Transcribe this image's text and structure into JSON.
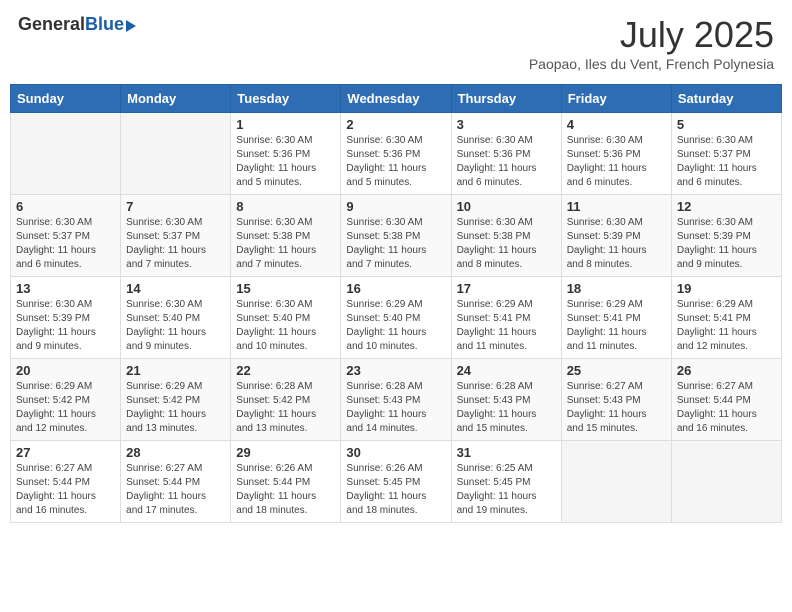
{
  "header": {
    "logo_general": "General",
    "logo_blue": "Blue",
    "month_title": "July 2025",
    "location": "Paopao, Iles du Vent, French Polynesia"
  },
  "weekdays": [
    "Sunday",
    "Monday",
    "Tuesday",
    "Wednesday",
    "Thursday",
    "Friday",
    "Saturday"
  ],
  "weeks": [
    [
      {
        "day": "",
        "info": ""
      },
      {
        "day": "",
        "info": ""
      },
      {
        "day": "1",
        "info": "Sunrise: 6:30 AM\nSunset: 5:36 PM\nDaylight: 11 hours and 5 minutes."
      },
      {
        "day": "2",
        "info": "Sunrise: 6:30 AM\nSunset: 5:36 PM\nDaylight: 11 hours and 5 minutes."
      },
      {
        "day": "3",
        "info": "Sunrise: 6:30 AM\nSunset: 5:36 PM\nDaylight: 11 hours and 6 minutes."
      },
      {
        "day": "4",
        "info": "Sunrise: 6:30 AM\nSunset: 5:36 PM\nDaylight: 11 hours and 6 minutes."
      },
      {
        "day": "5",
        "info": "Sunrise: 6:30 AM\nSunset: 5:37 PM\nDaylight: 11 hours and 6 minutes."
      }
    ],
    [
      {
        "day": "6",
        "info": "Sunrise: 6:30 AM\nSunset: 5:37 PM\nDaylight: 11 hours and 6 minutes."
      },
      {
        "day": "7",
        "info": "Sunrise: 6:30 AM\nSunset: 5:37 PM\nDaylight: 11 hours and 7 minutes."
      },
      {
        "day": "8",
        "info": "Sunrise: 6:30 AM\nSunset: 5:38 PM\nDaylight: 11 hours and 7 minutes."
      },
      {
        "day": "9",
        "info": "Sunrise: 6:30 AM\nSunset: 5:38 PM\nDaylight: 11 hours and 7 minutes."
      },
      {
        "day": "10",
        "info": "Sunrise: 6:30 AM\nSunset: 5:38 PM\nDaylight: 11 hours and 8 minutes."
      },
      {
        "day": "11",
        "info": "Sunrise: 6:30 AM\nSunset: 5:39 PM\nDaylight: 11 hours and 8 minutes."
      },
      {
        "day": "12",
        "info": "Sunrise: 6:30 AM\nSunset: 5:39 PM\nDaylight: 11 hours and 9 minutes."
      }
    ],
    [
      {
        "day": "13",
        "info": "Sunrise: 6:30 AM\nSunset: 5:39 PM\nDaylight: 11 hours and 9 minutes."
      },
      {
        "day": "14",
        "info": "Sunrise: 6:30 AM\nSunset: 5:40 PM\nDaylight: 11 hours and 9 minutes."
      },
      {
        "day": "15",
        "info": "Sunrise: 6:30 AM\nSunset: 5:40 PM\nDaylight: 11 hours and 10 minutes."
      },
      {
        "day": "16",
        "info": "Sunrise: 6:29 AM\nSunset: 5:40 PM\nDaylight: 11 hours and 10 minutes."
      },
      {
        "day": "17",
        "info": "Sunrise: 6:29 AM\nSunset: 5:41 PM\nDaylight: 11 hours and 11 minutes."
      },
      {
        "day": "18",
        "info": "Sunrise: 6:29 AM\nSunset: 5:41 PM\nDaylight: 11 hours and 11 minutes."
      },
      {
        "day": "19",
        "info": "Sunrise: 6:29 AM\nSunset: 5:41 PM\nDaylight: 11 hours and 12 minutes."
      }
    ],
    [
      {
        "day": "20",
        "info": "Sunrise: 6:29 AM\nSunset: 5:42 PM\nDaylight: 11 hours and 12 minutes."
      },
      {
        "day": "21",
        "info": "Sunrise: 6:29 AM\nSunset: 5:42 PM\nDaylight: 11 hours and 13 minutes."
      },
      {
        "day": "22",
        "info": "Sunrise: 6:28 AM\nSunset: 5:42 PM\nDaylight: 11 hours and 13 minutes."
      },
      {
        "day": "23",
        "info": "Sunrise: 6:28 AM\nSunset: 5:43 PM\nDaylight: 11 hours and 14 minutes."
      },
      {
        "day": "24",
        "info": "Sunrise: 6:28 AM\nSunset: 5:43 PM\nDaylight: 11 hours and 15 minutes."
      },
      {
        "day": "25",
        "info": "Sunrise: 6:27 AM\nSunset: 5:43 PM\nDaylight: 11 hours and 15 minutes."
      },
      {
        "day": "26",
        "info": "Sunrise: 6:27 AM\nSunset: 5:44 PM\nDaylight: 11 hours and 16 minutes."
      }
    ],
    [
      {
        "day": "27",
        "info": "Sunrise: 6:27 AM\nSunset: 5:44 PM\nDaylight: 11 hours and 16 minutes."
      },
      {
        "day": "28",
        "info": "Sunrise: 6:27 AM\nSunset: 5:44 PM\nDaylight: 11 hours and 17 minutes."
      },
      {
        "day": "29",
        "info": "Sunrise: 6:26 AM\nSunset: 5:44 PM\nDaylight: 11 hours and 18 minutes."
      },
      {
        "day": "30",
        "info": "Sunrise: 6:26 AM\nSunset: 5:45 PM\nDaylight: 11 hours and 18 minutes."
      },
      {
        "day": "31",
        "info": "Sunrise: 6:25 AM\nSunset: 5:45 PM\nDaylight: 11 hours and 19 minutes."
      },
      {
        "day": "",
        "info": ""
      },
      {
        "day": "",
        "info": ""
      }
    ]
  ]
}
